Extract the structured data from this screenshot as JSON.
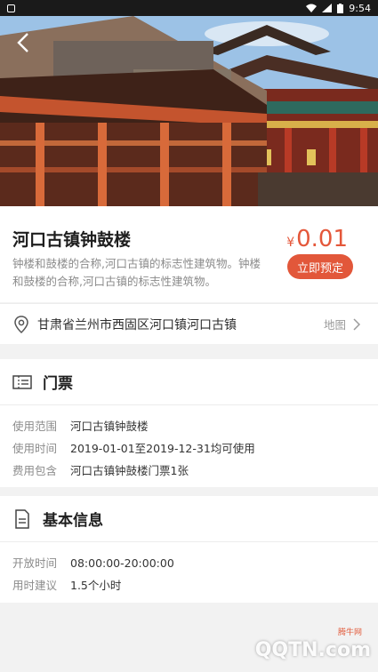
{
  "status_bar": {
    "time": "9:54"
  },
  "attraction": {
    "title": "河口古镇钟鼓楼",
    "price_currency": "¥",
    "price_value": "0.01",
    "book_label": "立即预定",
    "description": "钟楼和鼓楼的合称,河口古镇的标志性建筑物。钟楼和鼓楼的合称,河口古镇的标志性建筑物。"
  },
  "address": {
    "text": "甘肃省兰州市西固区河口镇河口古镇",
    "map_label": "地图"
  },
  "ticket_section": {
    "title": "门票",
    "rows": [
      {
        "key": "使用范围",
        "value": "河口古镇钟鼓楼"
      },
      {
        "key": "使用时间",
        "value": "2019-01-01至2019-12-31均可使用"
      },
      {
        "key": "费用包含",
        "value": "河口古镇钟鼓楼门票1张"
      }
    ]
  },
  "info_section": {
    "title": "基本信息",
    "rows": [
      {
        "key": "开放时间",
        "value": "08:00:00-20:00:00"
      },
      {
        "key": "用时建议",
        "value": "1.5个小时"
      }
    ]
  },
  "watermark": {
    "text": "QQTN.com",
    "sub": "腾牛网"
  }
}
